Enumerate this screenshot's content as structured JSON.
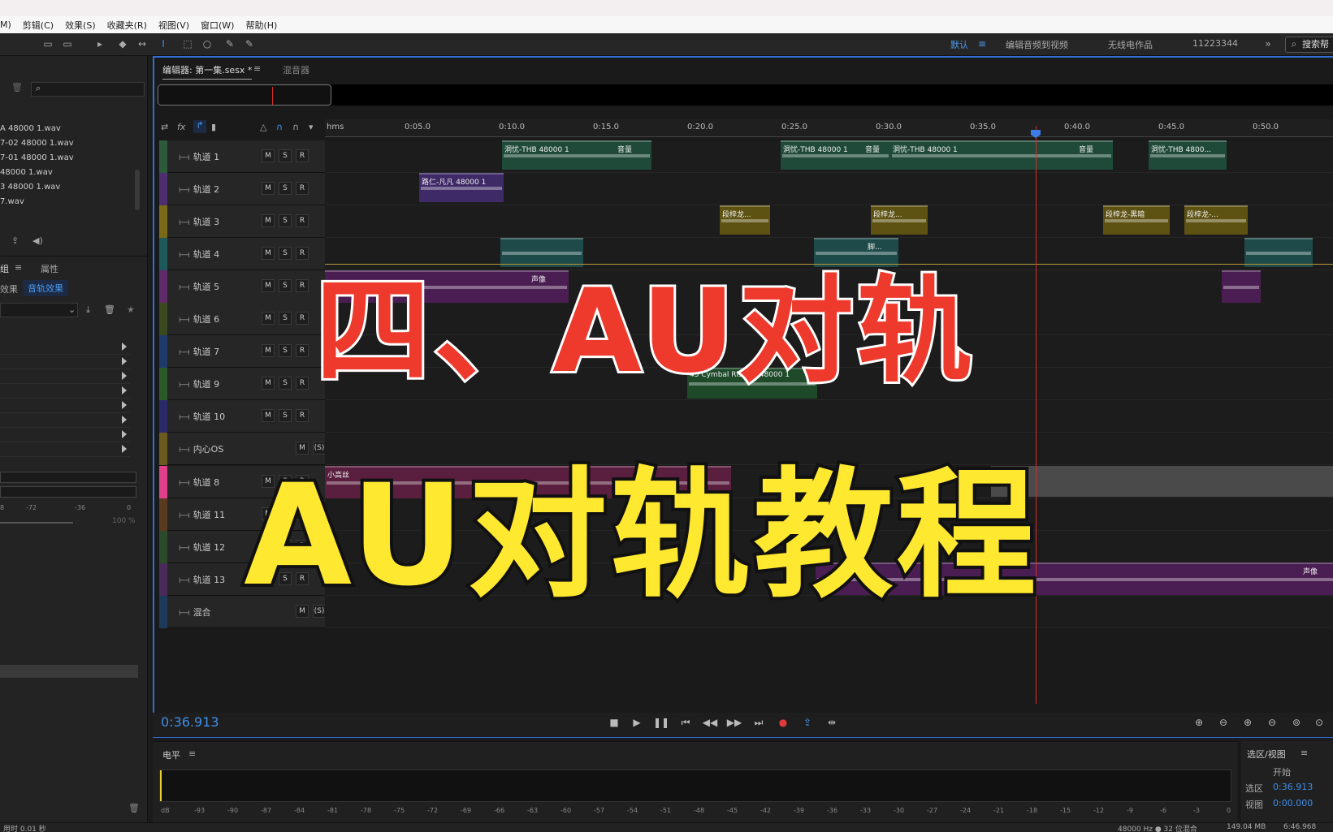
{
  "menubar": {
    "items": [
      "M)",
      "剪辑(C)",
      "效果(S)",
      "收藏夹(R)",
      "视图(V)",
      "窗口(W)",
      "帮助(H)"
    ]
  },
  "toolbar": {
    "workspaces": [
      "默认",
      "编辑音频到视频",
      "无线电作品",
      "11223344"
    ],
    "search_placeholder": "搜索帮"
  },
  "left_panel": {
    "files": [
      "A 48000 1.wav",
      "7-02 48000 1.wav",
      "7-01 48000 1.wav",
      "48000 1.wav",
      "3 48000 1.wav",
      "7.wav"
    ],
    "tabs": [
      "组",
      "属性"
    ],
    "subtabs": [
      "效果",
      "音轨效果"
    ],
    "meter_ticks": [
      "8",
      "-72",
      "-36",
      "0"
    ],
    "pct": "100 %",
    "status": "用时 0.01 秒"
  },
  "editor": {
    "tabs": [
      "编辑器: 第一集.sesx *",
      "混音器"
    ],
    "ruler_unit": "hms",
    "ruler_ticks": [
      "0:05.0",
      "0:10.0",
      "0:15.0",
      "0:20.0",
      "0:25.0",
      "0:30.0",
      "0:35.0",
      "0:40.0",
      "0:45.0",
      "0:50.0"
    ],
    "tracks": [
      {
        "name": "轨道 1",
        "color": "#2e5a3c",
        "buttons": [
          "M",
          "S",
          "R"
        ]
      },
      {
        "name": "轨道 2",
        "color": "#4e2e6e",
        "buttons": [
          "M",
          "S",
          "R"
        ]
      },
      {
        "name": "轨道 3",
        "color": "#7a6a16",
        "buttons": [
          "M",
          "S",
          "R"
        ]
      },
      {
        "name": "轨道 4",
        "color": "#1e5a5a",
        "buttons": [
          "M",
          "S",
          "R"
        ]
      },
      {
        "name": "轨道 5",
        "color": "#5e2a6a",
        "buttons": [
          "M",
          "S",
          "R"
        ]
      },
      {
        "name": "轨道 6",
        "color": "#3a4a1e",
        "buttons": [
          "M",
          "S",
          "R"
        ]
      },
      {
        "name": "轨道 7",
        "color": "#1e3a6a",
        "buttons": [
          "M",
          "S",
          "R"
        ]
      },
      {
        "name": "轨道 9",
        "color": "#2a5a2a",
        "buttons": [
          "M",
          "S",
          "R"
        ]
      },
      {
        "name": "轨道 10",
        "color": "#2a2a6a",
        "buttons": [
          "M",
          "S",
          "R"
        ]
      },
      {
        "name": "内心OS",
        "color": "#6a5a1e",
        "buttons": [
          "M",
          "(S)"
        ]
      },
      {
        "name": "轨道 8",
        "color": "#e0408a",
        "buttons": [
          "M",
          "S",
          "R"
        ]
      },
      {
        "name": "轨道 11",
        "color": "#5a3a1e",
        "buttons": [
          "M",
          "S",
          "R"
        ]
      },
      {
        "name": "轨道 12",
        "color": "#2a4a2a",
        "buttons": [
          "M",
          "S",
          "R"
        ]
      },
      {
        "name": "轨道 13",
        "color": "#4a2a5a",
        "buttons": [
          "M",
          "S",
          "R"
        ]
      },
      {
        "name": "混合",
        "color": "#1e3a5a",
        "buttons": [
          "M",
          "(S)"
        ]
      }
    ],
    "clips": {
      "t1a": "洞忧-THB 48000 1",
      "t1a_vol": "音量",
      "t1b": "洞忧-THB 48000 1",
      "t1b_vol": "音量",
      "t1c": "洞忧-THB 48000 1",
      "t1c_vol": "音量",
      "t1d": "洞忧-THB 4800...",
      "t2a": "路仁-凡凡 48000 1",
      "t3a": "段梓龙...",
      "t3b": "段梓龙...",
      "t3c": "段梓龙-黑暗",
      "t3d": "段梓龙-...",
      "t4a": "脚...",
      "t5a": "声像",
      "t9a": "45 Cymbal Riser A 48000 1",
      "t8a": "小高丝",
      "t13a": "声像"
    },
    "timecode": "0:36.913"
  },
  "level_panel": {
    "title": "电平",
    "db_ticks": [
      "dB",
      "-93",
      "-90",
      "-87",
      "-84",
      "-81",
      "-78",
      "-75",
      "-72",
      "-69",
      "-66",
      "-63",
      "-60",
      "-57",
      "-54",
      "-51",
      "-48",
      "-45",
      "-42",
      "-39",
      "-36",
      "-33",
      "-30",
      "-27",
      "-24",
      "-21",
      "-18",
      "-15",
      "-12",
      "-9",
      "-6",
      "-3",
      "0"
    ]
  },
  "selection_panel": {
    "title": "选区/视图",
    "col_start": "开始",
    "sel_label": "选区",
    "sel_value": "0:36.913",
    "view_label": "视图",
    "view_value": "0:00.000"
  },
  "statusbar": {
    "info": "48000 Hz ● 32 位混合",
    "mem": "149.04 MB",
    "dur": "6:46.968"
  },
  "overlay": {
    "red_title": "四、AU对轨",
    "yellow_title": "AU对轨教程"
  }
}
